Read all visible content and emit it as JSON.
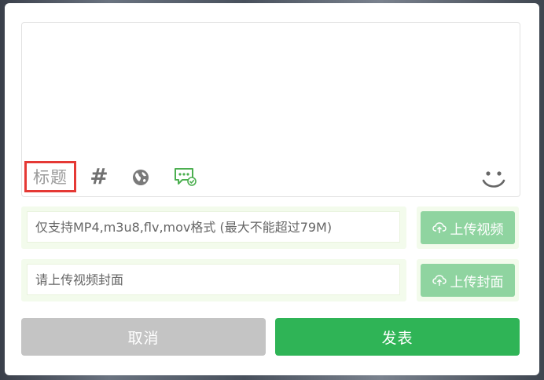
{
  "editor": {
    "title_button_label": "标题",
    "hashtag_symbol": "#",
    "icons": [
      "globe-icon",
      "message-check-icon",
      "smile-icon"
    ]
  },
  "video": {
    "placeholder": "仅支持MP4,m3u8,flv,mov格式 (最大不能超过79M)",
    "upload_label": "上传视频",
    "upload_icon": "cloud-upload-icon"
  },
  "cover": {
    "placeholder": "请上传视频封面",
    "upload_label": "上传封面",
    "upload_icon": "cloud-upload-icon"
  },
  "actions": {
    "cancel_label": "取消",
    "publish_label": "发表"
  },
  "colors": {
    "accent": "#2fb456",
    "upload_button": "#8fd4a0",
    "cancel_button": "#c4c4c4",
    "title_highlight": "#e53935",
    "row_background": "#f3fbec"
  }
}
